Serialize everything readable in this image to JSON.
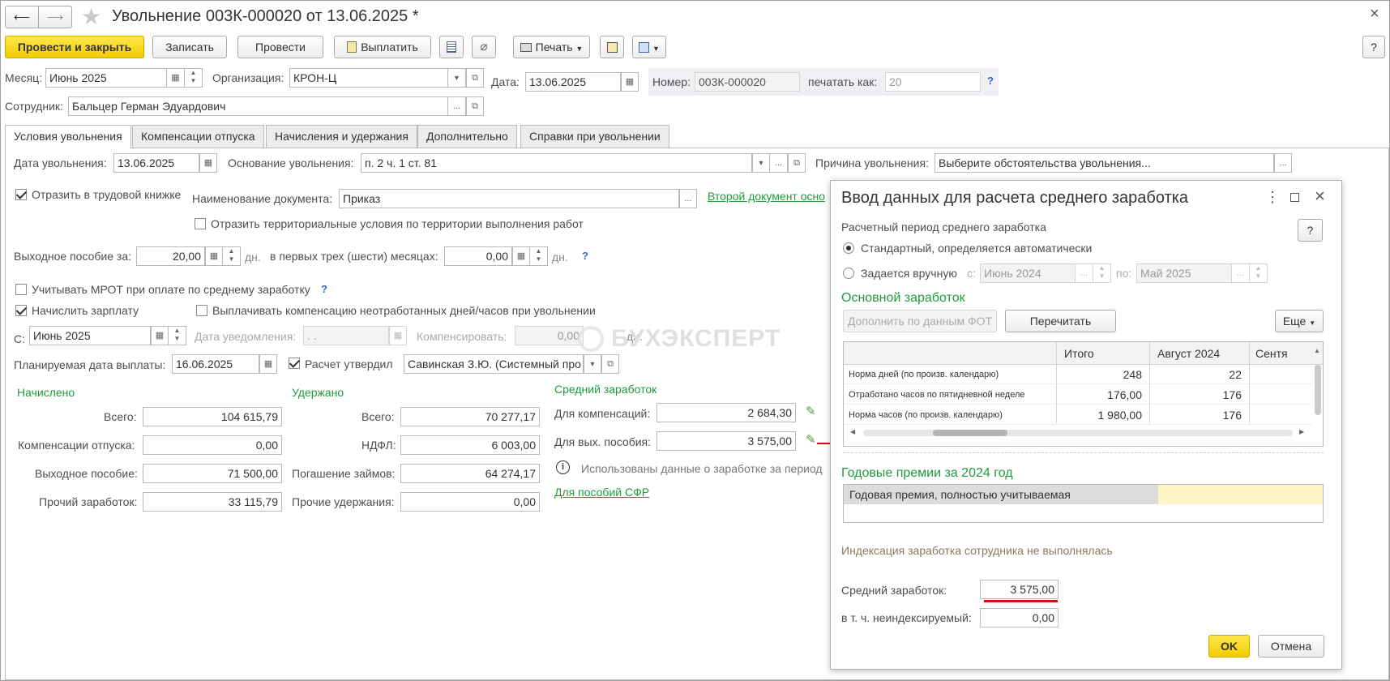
{
  "window": {
    "title": "Увольнение 003К-000020 от 13.06.2025 *",
    "close": "×"
  },
  "nav": {
    "back": "⟵",
    "forward": "⟶",
    "star": "★"
  },
  "toolbar": {
    "post_close": "Провести и закрыть",
    "save": "Записать",
    "post": "Провести",
    "pay": "Выплатить",
    "print": "Печать",
    "help": "?"
  },
  "header": {
    "month_label": "Месяц:",
    "month_value": "Июнь 2025",
    "org_label": "Организация:",
    "org_value": "КРОН-Ц",
    "date_label": "Дата:",
    "date_value": "13.06.2025",
    "number_label": "Номер:",
    "number_value": "003К-000020",
    "print_as_label": "печатать как:",
    "print_as_value": "20",
    "employee_label": "Сотрудник:",
    "employee_value": "Бальцер Герман Эдуардович",
    "q": "?"
  },
  "tabs": [
    "Условия увольнения",
    "Компенсации отпуска",
    "Начисления и удержания",
    "Дополнительно",
    "Справки при увольнении"
  ],
  "form": {
    "dismissal_date_label": "Дата увольнения:",
    "dismissal_date_value": "13.06.2025",
    "basis_label": "Основание увольнения:",
    "basis_value": "п. 2 ч. 1 ст. 81",
    "reason_label": "Причина увольнения:",
    "reason_value": "Выберите обстоятельства увольнения...",
    "workbook_label": "Отразить в трудовой книжке",
    "docname_label": "Наименование документа:",
    "docname_value": "Приказ",
    "second_doc_link": "Второй документ осно",
    "territorial_label": "Отразить территориальные условия по территории выполнения работ",
    "severance_label": "Выходное пособие за:",
    "severance_value": "20,00",
    "days1": "дн.",
    "first_months_label": "в первых трех (шести) месяцах:",
    "first_months_value": "0,00",
    "days2": "дн.",
    "mrot_label": "Учитывать МРОТ при оплате по среднему заработку",
    "accrue_label": "Начислить зарплату",
    "compensate_label": "Выплачивать компенсацию неотработанных дней/часов при увольнении",
    "from_label": "С:",
    "from_value": "Июнь 2025",
    "notice_label": "Дата уведомления:",
    "notice_value": " .  .",
    "compensate_amount_label": "Компенсировать:",
    "compensate_amount_value": "0,00",
    "days3": "дн.",
    "planned_label": "Планируемая дата выплаты:",
    "planned_value": "16.06.2025",
    "approved_label": "Расчет утвердил",
    "approved_value": "Савинская З.Ю. (Системный про",
    "q": "?"
  },
  "accrued": {
    "title": "Начислено",
    "total_label": "Всего:",
    "total": "104 615,79",
    "vac_label": "Компенсации отпуска:",
    "vac": "0,00",
    "sev_label": "Выходное пособие:",
    "sev": "71 500,00",
    "other_label": "Прочий заработок:",
    "other": "33 115,79"
  },
  "withheld": {
    "title": "Удержано",
    "total_label": "Всего:",
    "total": "70 277,17",
    "ndfl_label": "НДФЛ:",
    "ndfl": "6 003,00",
    "loans_label": "Погашение займов:",
    "loans": "64 274,17",
    "other_label": "Прочие удержания:",
    "other": "0,00"
  },
  "avg": {
    "title": "Средний заработок",
    "comp_label": "Для компенсаций:",
    "comp": "2 684,30",
    "sev_label": "Для вых. пособия:",
    "sev": "3 575,00",
    "info": "Использованы данные о заработке за период",
    "sfr_link": "Для пособий СФР",
    "info_icon": "i"
  },
  "watermark": "БУХЭКСПЕРТ",
  "dialog": {
    "title": "Ввод данных для расчета среднего заработка",
    "period_title": "Расчетный период среднего заработка",
    "standard": "Стандартный, определяется автоматически",
    "manual": "Задается вручную",
    "from_label": "с:",
    "from_value": "Июнь 2024",
    "to_label": "по:",
    "to_value": "Май 2025",
    "main_title": "Основной заработок",
    "fill_btn": "Дополнить по данным ФОТ",
    "reread_btn": "Перечитать",
    "more_btn": "Еще",
    "table": {
      "headers": [
        "",
        "Итого",
        "Август 2024",
        "Сентя"
      ],
      "rows": [
        {
          "name": "Норма дней (по произв. календарю)",
          "total": "248",
          "aug": "22"
        },
        {
          "name": "Отработано часов по пятидневной неделе",
          "total": "176,00",
          "aug": "176"
        },
        {
          "name": "Норма часов (по произв. календарю)",
          "total": "1 980,00",
          "aug": "176"
        }
      ]
    },
    "bonus_title": "Годовые премии за 2024 год",
    "bonus_row": "Годовая премия, полностью учитываемая",
    "indexing": "Индексация заработка сотрудника не выполнялась",
    "avg_label": "Средний заработок:",
    "avg_value": "3 575,00",
    "nonindex_label": "в т. ч. неиндексируемый:",
    "nonindex_value": "0,00",
    "ok": "OK",
    "cancel": "Отмена",
    "help": "?"
  }
}
